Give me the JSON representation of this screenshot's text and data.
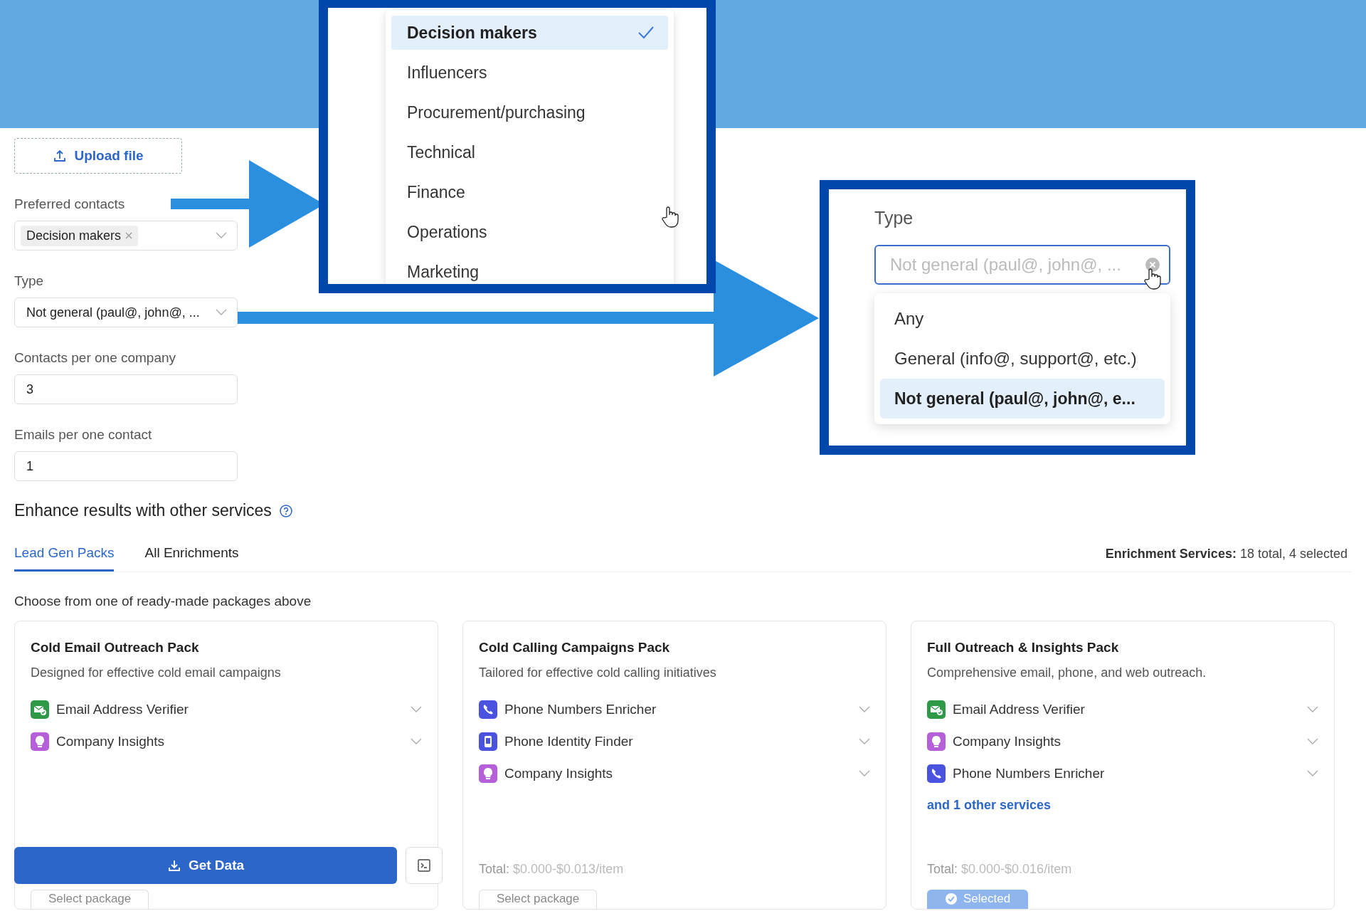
{
  "upload_button": {
    "label": "Upload file"
  },
  "fields": [
    {
      "kind": "tags",
      "label": "Preferred contacts",
      "tags": [
        "Decision makers"
      ]
    },
    {
      "kind": "select",
      "label": "Type",
      "value": "Not general (paul@, john@, ..."
    },
    {
      "kind": "input",
      "label": "Contacts per one company",
      "value": "3"
    },
    {
      "kind": "input",
      "label": "Emails per one contact",
      "value": "1"
    }
  ],
  "enhance": {
    "title": "Enhance results with other services"
  },
  "tabs": [
    {
      "label": "Lead Gen Packs",
      "selected": true
    },
    {
      "label": "All Enrichments",
      "selected": false
    }
  ],
  "summary": "**Enrichment Services:** 18 total, 4 selected",
  "hint": "Choose from one of ready-made packages above",
  "packs": [
    {
      "title": "Cold Email Outreach Pack",
      "description": "Designed for effective cold email campaigns",
      "services": [
        {
          "kind": "email",
          "name": "Email Address Verifier"
        },
        {
          "kind": "insights",
          "name": "Company Insights"
        }
      ],
      "button": {
        "label": "Select package",
        "selected": false
      }
    },
    {
      "title": "Cold Calling Campaigns Pack",
      "description": "Tailored for effective cold calling initiatives",
      "services": [
        {
          "kind": "phone",
          "name": "Phone Numbers Enricher"
        },
        {
          "kind": "identity",
          "name": "Phone Identity Finder"
        },
        {
          "kind": "insights",
          "name": "Company Insights"
        }
      ],
      "total_label": "Total:",
      "total": "$0.000-$0.013/item",
      "button": {
        "label": "Select package",
        "selected": false
      }
    },
    {
      "title": "Full Outreach & Insights Pack",
      "description": "Comprehensive email, phone, and web outreach.",
      "services": [
        {
          "kind": "email",
          "name": "Email Address Verifier"
        },
        {
          "kind": "insights",
          "name": "Company Insights"
        },
        {
          "kind": "phone",
          "name": "Phone Numbers Enricher"
        }
      ],
      "more": "and 1 other services",
      "total_label": "Total:",
      "total": "$0.000-$0.016/item",
      "button": {
        "label": "Selected",
        "selected": true
      }
    }
  ],
  "footer": {
    "get_data": "Get Data"
  },
  "callouts": [
    {
      "kind": "list",
      "options": [
        {
          "label": "Decision makers",
          "selected": true
        },
        {
          "label": "Influencers",
          "selected": false
        },
        {
          "label": "Procurement/purchasing",
          "selected": false
        },
        {
          "label": "Technical",
          "selected": false
        },
        {
          "label": "Finance",
          "selected": false
        },
        {
          "label": "Operations",
          "selected": false
        },
        {
          "label": "Marketing",
          "selected": false
        }
      ]
    },
    {
      "kind": "select",
      "label": "Type",
      "placeholder": "Not general (paul@, john@, ...",
      "options": [
        {
          "label": "Any",
          "selected": false
        },
        {
          "label": "General (info@, support@, etc.)",
          "selected": false
        },
        {
          "label": "Not general (paul@, john@, e...",
          "selected": true
        }
      ]
    }
  ]
}
